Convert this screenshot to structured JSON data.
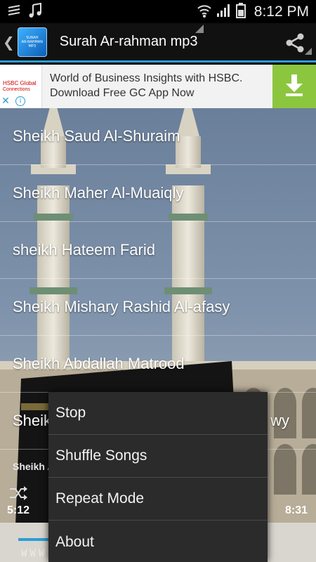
{
  "status_bar": {
    "time": "8:12 PM",
    "icons": [
      "notification-icon",
      "music-icon",
      "wifi-icon",
      "signal-icon",
      "battery-icon"
    ]
  },
  "action_bar": {
    "title": "Surah Ar-rahman mp3",
    "app_icon_text": [
      "SURAH",
      "AR-RAHMAN",
      "MP3"
    ],
    "accent_color": "#2a9ed6"
  },
  "ad": {
    "logo_line1": "HSBC Global",
    "logo_line2": "Connections",
    "line1": "World of Business Insights with HSBC.",
    "line2": "Download Free GC App Now",
    "download_color": "#8cc63f"
  },
  "songs": [
    "Sheikh Saud Al-Shuraim",
    "Sheikh Maher Al-Muaiqly",
    "sheikh Hateem Farid",
    "Sheikh Mishary Rashid Al-afasy",
    "Sheikh Abdallah Matrood",
    "Sheikh",
    "wy"
  ],
  "player": {
    "now_playing": "Sheikh A",
    "elapsed": "5:12",
    "total": "8:31",
    "progress_fraction": 0.07
  },
  "watermark": "WWW.ISL                LAWS.C",
  "menu": [
    "Stop",
    "Shuffle Songs",
    "Repeat Mode",
    "About"
  ]
}
